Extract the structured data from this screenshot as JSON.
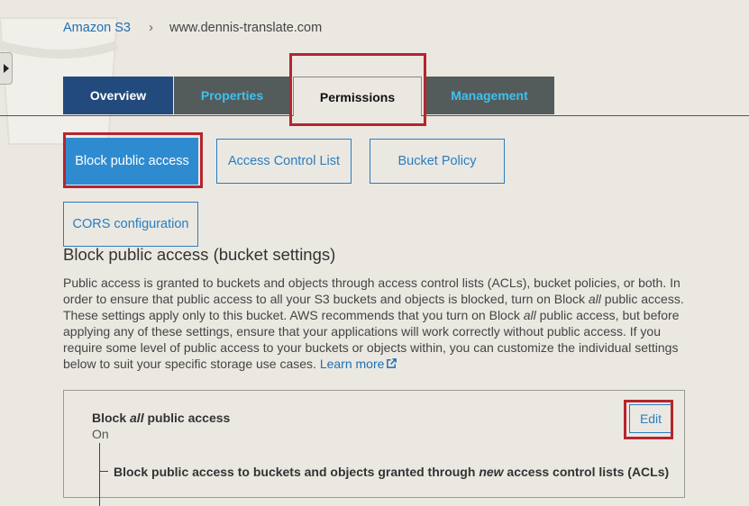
{
  "breadcrumb": {
    "root": "Amazon S3",
    "separator": "›",
    "current": "www.dennis-translate.com"
  },
  "tabs": [
    {
      "label": "Overview"
    },
    {
      "label": "Properties"
    },
    {
      "label": "Permissions"
    },
    {
      "label": "Management"
    }
  ],
  "subtabs": [
    {
      "label": "Block public access"
    },
    {
      "label": "Access Control List"
    },
    {
      "label": "Bucket Policy"
    },
    {
      "label": "CORS configuration"
    }
  ],
  "section": {
    "title": "Block public access (bucket settings)",
    "desc_1": "Public access is granted to buckets and objects through access control lists (ACLs), bucket policies, or both. In order to ensure that public access to all your S3 buckets and objects is blocked, turn on Block ",
    "desc_em1": "all",
    "desc_2": " public access. These settings apply only to this bucket. AWS recommends that you turn on Block ",
    "desc_em2": "all",
    "desc_3": " public access, but before applying any of these settings, ensure that your applications will work correctly without public access. If you require some level of public access to your buckets or objects within, you can customize the individual settings below to suit your specific storage use cases. ",
    "learn_more": "Learn more"
  },
  "panel": {
    "title_pre": "Block ",
    "title_em": "all",
    "title_post": " public access",
    "status": "On",
    "edit_label": "Edit",
    "sub_pre": "Block public access to buckets and objects granted through ",
    "sub_em": "new",
    "sub_post": " access control lists (ACLs)"
  },
  "colors": {
    "accent": "#2e8bd0",
    "highlight": "#b5262e",
    "tab_active_dark": "#234a7c",
    "tab_inactive": "#545b5b",
    "tab_text": "#3dc2f0"
  },
  "icons": {
    "sidebar_toggle": "caret-right-icon",
    "external_link": "external-link-icon",
    "breadcrumb_separator": "chevron-right-icon"
  }
}
